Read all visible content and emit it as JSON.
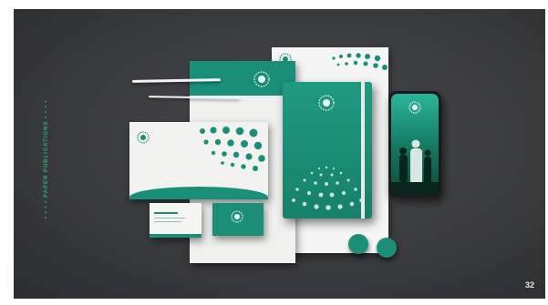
{
  "slide": {
    "side_label": "• • • • PAPER PUBLICATIONS • • • •",
    "page_number": "32"
  },
  "colors": {
    "background": "#3a3b3e",
    "brand_green": "#1a8f78",
    "paper": "#f4f5f4"
  },
  "icons": {
    "logo": "dotted-sphere-logo"
  }
}
